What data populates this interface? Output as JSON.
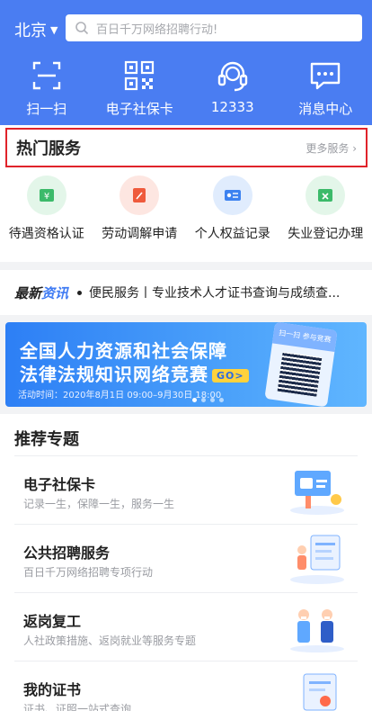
{
  "header": {
    "city": "北京",
    "search_placeholder": "百日千万网络招聘行动!",
    "quick_actions": [
      {
        "label": "扫一扫",
        "icon": "scan-icon"
      },
      {
        "label": "电子社保卡",
        "icon": "qr-code-icon"
      },
      {
        "label": "12333",
        "icon": "headset-icon"
      },
      {
        "label": "消息中心",
        "icon": "message-icon"
      }
    ]
  },
  "hot_services": {
    "title": "热门服务",
    "more": "更多服务 ›",
    "items": [
      {
        "label": "待遇资格认证",
        "icon": "yuan-badge-icon",
        "color": "#3cba6a"
      },
      {
        "label": "劳动调解申请",
        "icon": "edit-document-icon",
        "color": "#ef5a3c"
      },
      {
        "label": "个人权益记录",
        "icon": "id-card-icon",
        "color": "#3d82f0"
      },
      {
        "label": "失业登记办理",
        "icon": "register-form-icon",
        "color": "#3cba6a"
      }
    ]
  },
  "news": {
    "tag_a": "最新",
    "tag_b": "资讯",
    "text": "便民服务丨专业技术人才证书查询与成绩查..."
  },
  "banner": {
    "line1": "全国人力资源和社会保障",
    "line2": "法律法规知识网络竞赛",
    "go": "GO>",
    "time": "活动时间：2020年8月1日 09:00–9月30日 18:00",
    "card_header": "扫一扫 参与竞赛"
  },
  "recommended": {
    "title": "推荐专题",
    "items": [
      {
        "name": "电子社保卡",
        "desc": "记录一生，保障一生，服务一生",
        "icon": "social-card-illustration"
      },
      {
        "name": "公共招聘服务",
        "desc": "百日千万网络招聘专项行动",
        "icon": "recruitment-illustration"
      },
      {
        "name": "返岗复工",
        "desc": "人社政策措施、返岗就业等服务专题",
        "icon": "return-work-illustration"
      },
      {
        "name": "我的证书",
        "desc": "证书、证照一站式查询",
        "icon": "certificate-illustration"
      }
    ]
  }
}
